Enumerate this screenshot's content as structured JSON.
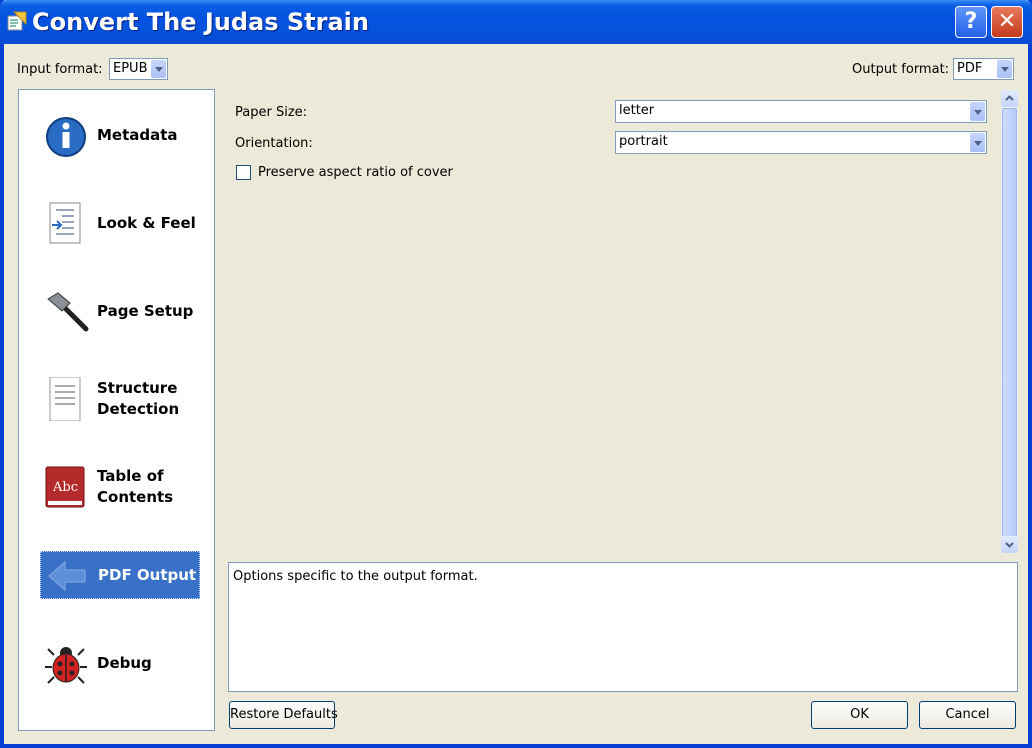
{
  "window": {
    "title": "Convert The Judas Strain",
    "help_glyph": "?",
    "close_glyph": "✕"
  },
  "formats": {
    "input_label": "Input format:",
    "input_value": "EPUB",
    "output_label": "Output format:",
    "output_value": "PDF"
  },
  "sidebar": {
    "items": [
      {
        "label": "Metadata",
        "icon": "info-icon"
      },
      {
        "label": "Look & Feel",
        "icon": "document-indent-icon"
      },
      {
        "label": "Page Setup",
        "icon": "hammer-icon"
      },
      {
        "label": "Structure Detection",
        "icon": "document-lines-icon"
      },
      {
        "label": "Table of Contents",
        "icon": "abc-book-icon"
      },
      {
        "label": "PDF Output",
        "icon": "back-arrow-icon",
        "selected": true
      },
      {
        "label": "Debug",
        "icon": "ladybug-icon"
      }
    ]
  },
  "options": {
    "paper_size_label": "Paper Size:",
    "paper_size_value": "letter",
    "orientation_label": "Orientation:",
    "orientation_value": "portrait",
    "preserve_aspect_label": "Preserve aspect ratio of cover",
    "preserve_aspect_checked": false
  },
  "description": "Options specific to the output format.",
  "buttons": {
    "restore": "Restore Defaults",
    "ok": "OK",
    "cancel": "Cancel"
  },
  "colors": {
    "title_bar": "#0552e0",
    "selected_item": "#3a71c8",
    "dialog_bg": "#ece9d8"
  }
}
